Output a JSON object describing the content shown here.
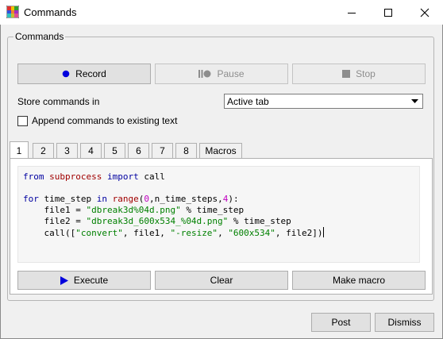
{
  "window": {
    "title": "Commands",
    "app_icon": "colorful-grid-icon",
    "controls": [
      "minimize-icon",
      "maximize-icon",
      "close-icon"
    ]
  },
  "commands_group": {
    "label": "Commands",
    "record_label": "Record",
    "pause_label": "Pause",
    "stop_label": "Stop",
    "store_label": "Store commands in",
    "store_selected": "Active tab",
    "append_label": "Append commands to existing text",
    "append_checked": false
  },
  "tabs": [
    "1",
    "2",
    "3",
    "4",
    "5",
    "6",
    "7",
    "8",
    "Macros"
  ],
  "active_tab": "1",
  "editor": {
    "l1": {
      "a": "from",
      "b": " ",
      "c": "subprocess",
      "d": " ",
      "e": "import",
      "f": " call"
    },
    "l3": {
      "a": "for",
      "b": " time_step ",
      "c": "in",
      "d": " ",
      "e": "range",
      "f": "(",
      "g": "0",
      "h": ",n_time_steps,",
      "i": "4",
      "j": "):"
    },
    "l4": {
      "a": "    file1 = ",
      "b": "\"dbreak3d%04d.png\"",
      "c": " % time_step"
    },
    "l5": {
      "a": "    file2 = ",
      "b": "\"dbreak3d_600x534_%04d.png\"",
      "c": " % time_step"
    },
    "l6": {
      "a": "    call([",
      "b": "\"convert\"",
      "c": ", file1, ",
      "d": "\"-resize\"",
      "e": ", ",
      "f": "\"600x534\"",
      "g": ", file2])"
    }
  },
  "tab_buttons": {
    "execute_label": "Execute",
    "clear_label": "Clear",
    "make_macro_label": "Make macro"
  },
  "footer": {
    "post_label": "Post",
    "dismiss_label": "Dismiss"
  },
  "colors": {
    "record_dot": "#0000dd",
    "execute_arrow": "#0000dd",
    "keyword": "#0000a0",
    "module": "#a00000",
    "string": "#008000",
    "number": "#c000c0"
  }
}
